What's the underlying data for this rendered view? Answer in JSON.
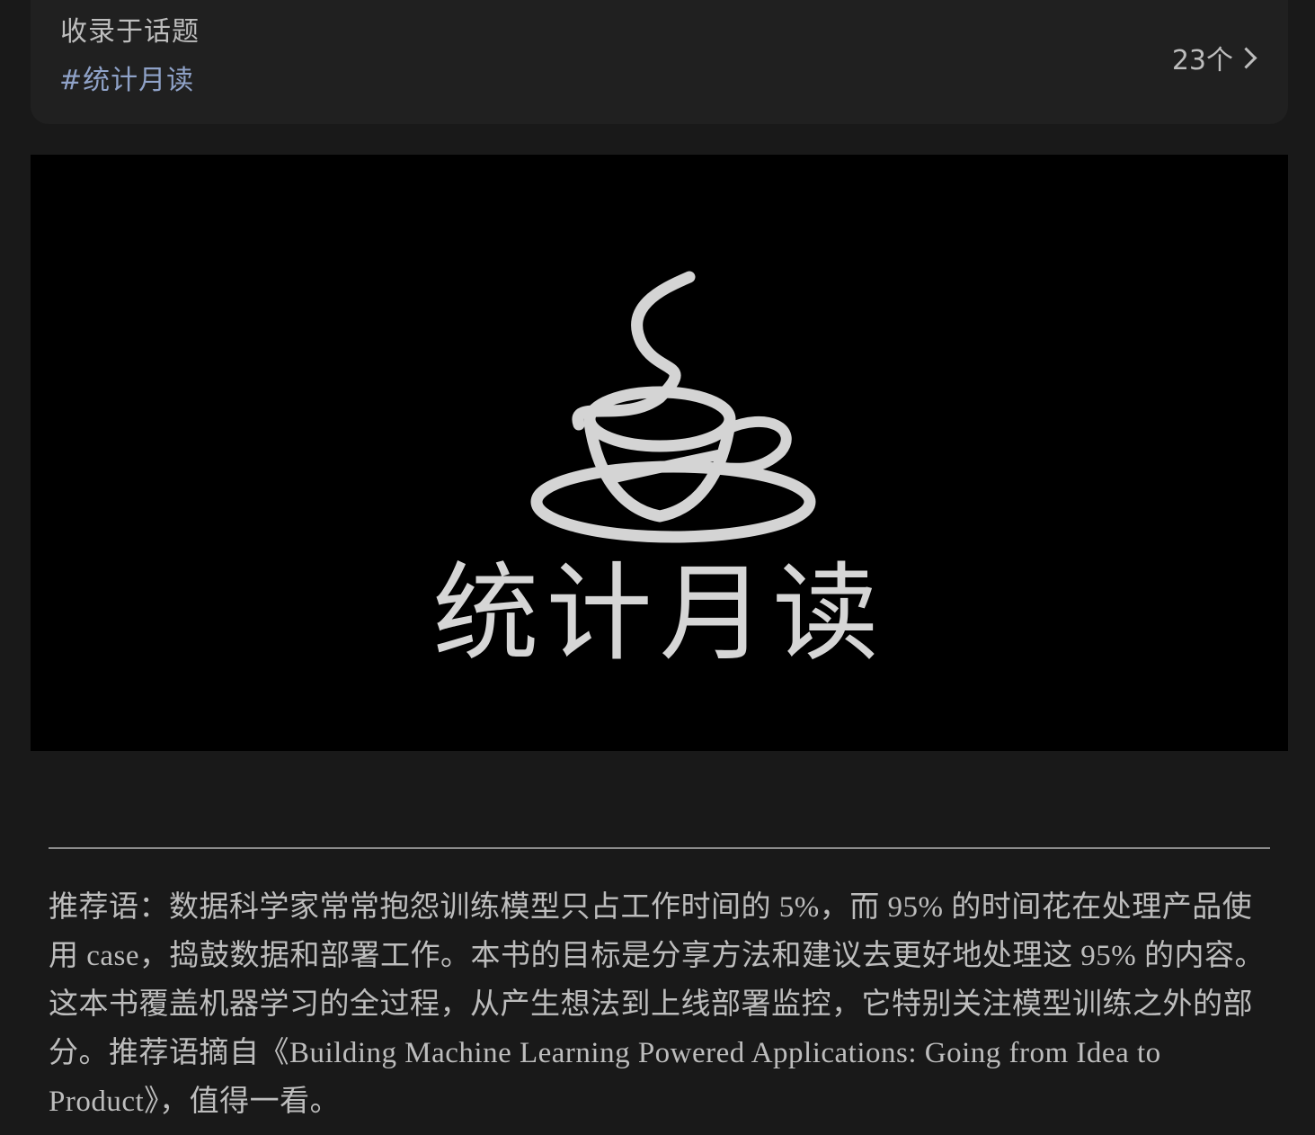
{
  "topic": {
    "heading": "收录于话题",
    "tag": "#统计月读",
    "count": "23个"
  },
  "banner": {
    "title": "统计月读",
    "logo": "coffee-cup-icon"
  },
  "article": {
    "recommendation": "推荐语：数据科学家常常抱怨训练模型只占工作时间的 5%，而 95% 的时间花在处理产品使用 case，捣鼓数据和部署工作。本书的目标是分享方法和建议去更好地处理这 95% 的内容。这本书覆盖机器学习的全过程，从产生想法到上线部署监控，它特别关注模型训练之外的部分。推荐语摘自《Building Machine Learning Powered Applications: Going from Idea to Product》，值得一看。"
  },
  "colors": {
    "background": "#191919",
    "card": "#202020",
    "tag": "#8fa2c8",
    "text": "#bdbdbd"
  }
}
